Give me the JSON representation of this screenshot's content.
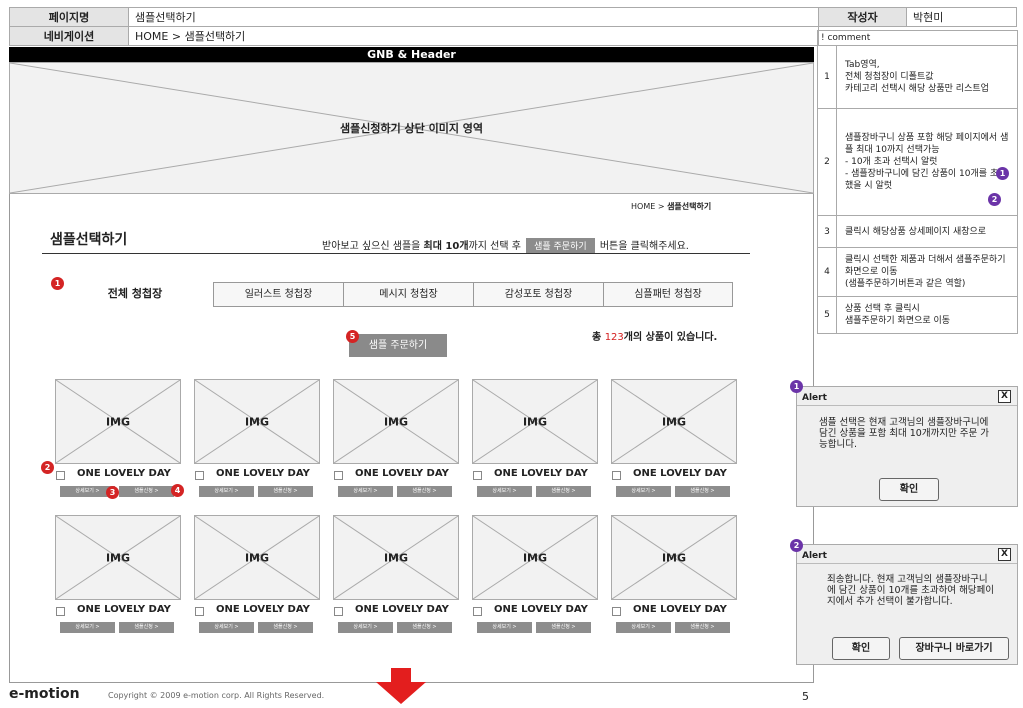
{
  "header": {
    "page_name_label": "페이지명",
    "page_name": "샘플선택하기",
    "nav_label": "네비게이션",
    "nav": "HOME > 샘플선택하기",
    "author_label": "작성자",
    "author": "박현미",
    "comment_label": "! comment"
  },
  "gnb": "GNB & Header",
  "hero": "샘플신청하기 상단 이미지 영역",
  "breadcrumb": {
    "home": "HOME >",
    "current": "샘플선택하기"
  },
  "page_title": "샘플선택하기",
  "guide": {
    "pre": "받아보고 싶으신 샘플을 ",
    "strong": "최대 10개",
    "mid": "까지 선택 후",
    "button": "샘플 주문하기",
    "post": "버튼을 클릭해주세요."
  },
  "tabs": [
    "전체 청첩장",
    "일러스트 청첩장",
    "메시지 청첩장",
    "감성포토 청첩장",
    "심플패턴 청첩장"
  ],
  "total": {
    "pre": "총 ",
    "count": "123",
    "post": "개의 상품이 있습니다."
  },
  "order_button": "샘플 주문하기",
  "product": {
    "img": "IMG",
    "name": "ONE LOVELY DAY",
    "detail": "상세보기 >",
    "apply": "샘플신청 >"
  },
  "badges": [
    "1",
    "2",
    "3",
    "4",
    "5"
  ],
  "comments": [
    {
      "n": "1",
      "text": "Tab영역,\n전체 청첩장이 디폴트값\n카테고리 선택시 해당 상품만 리스트업"
    },
    {
      "n": "2",
      "text": "샘플장바구니 상품 포함 해당 페이지에서 샘플 최대 10까지 선택가능\n- 10개 초과 선택시 알럿\n- 샘플장바구니에 담긴 상품이 10개를 초과했을 시 알럿"
    },
    {
      "n": "3",
      "text": "클릭시 해당상품 상세페이지 새창으로"
    },
    {
      "n": "4",
      "text": "클릭시 선택한 제품과 더해서 샘플주문하기 화면으로 이동\n(샘플주문하기버튼과 같은 역할)"
    },
    {
      "n": "5",
      "text": "상품 선택 후 클릭시\n샘플주문하기 화면으로 이동"
    }
  ],
  "alert1": {
    "title": "Alert",
    "close": "X",
    "body": "샘플 선택은 현재 고객님의 샘플장바구니에 담긴 상품을 포함 최대 10개까지만 주문 가능합니다.",
    "ok": "확인"
  },
  "alert2": {
    "title": "Alert",
    "close": "X",
    "body": "죄송합니다. 현재 고객님의 샘플장바구니에 담긴 상품이 10개를 초과하여 해당페이지에서 추가 선택이 불가합니다.",
    "ok": "확인",
    "cart": "장바구니 바로가기"
  },
  "footer": {
    "logo": "e-motion",
    "copyright": "Copyright © 2009 e-motion corp. All Rights Reserved.",
    "page": "5"
  },
  "colors": {
    "badge_red": "#d42424",
    "badge_purple": "#6b34a8",
    "arrow": "#e31e1e",
    "button_gray": "#8a8a8a"
  }
}
